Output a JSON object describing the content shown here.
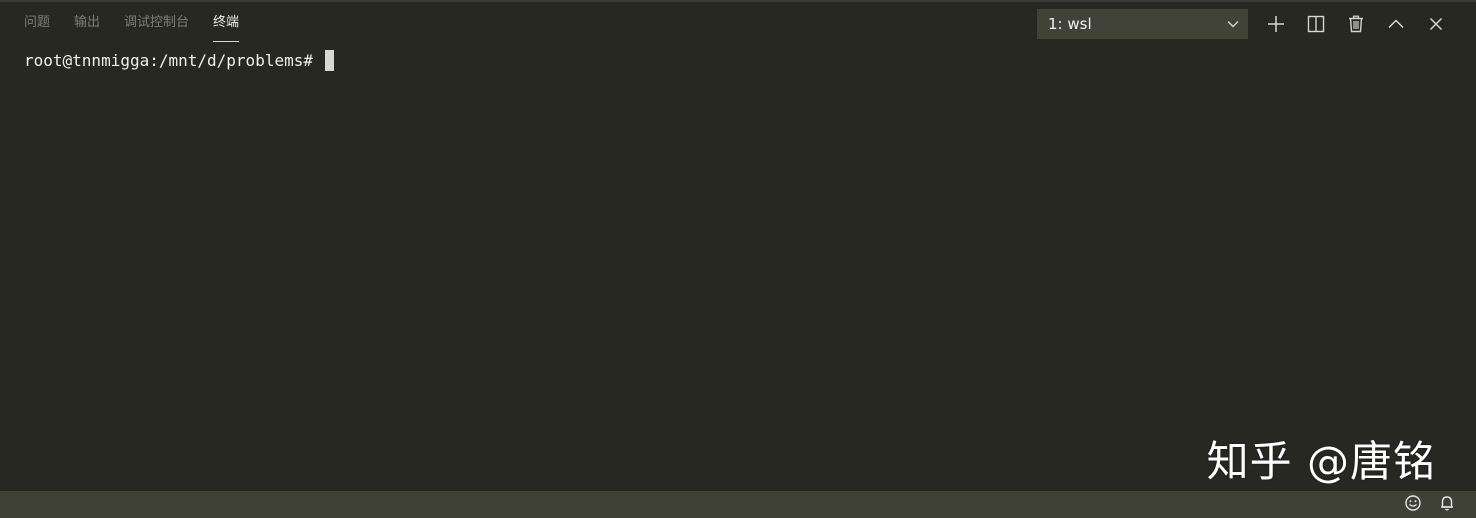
{
  "tabs": [
    {
      "label": "问题"
    },
    {
      "label": "输出"
    },
    {
      "label": "调试控制台"
    },
    {
      "label": "终端",
      "active": true
    }
  ],
  "terminal_select": {
    "value": "1: wsl",
    "icon": "chevron-down-icon"
  },
  "toolbar": {
    "icons": [
      "plus-icon",
      "split-icon",
      "trash-icon",
      "chevron-up-icon",
      "close-icon"
    ]
  },
  "terminal": {
    "prompt": "root@tnnmigga:/mnt/d/problems# "
  },
  "watermark": "知乎 @唐铭",
  "statusbar": {
    "icons": [
      "smiley-icon",
      "bell-icon"
    ]
  },
  "colors": {
    "background": "#272822",
    "tab_inactive": "#7c7e72",
    "tab_active": "#f0f0ea",
    "select_bg": "#414339",
    "statusbar_bg": "#3f4036"
  }
}
